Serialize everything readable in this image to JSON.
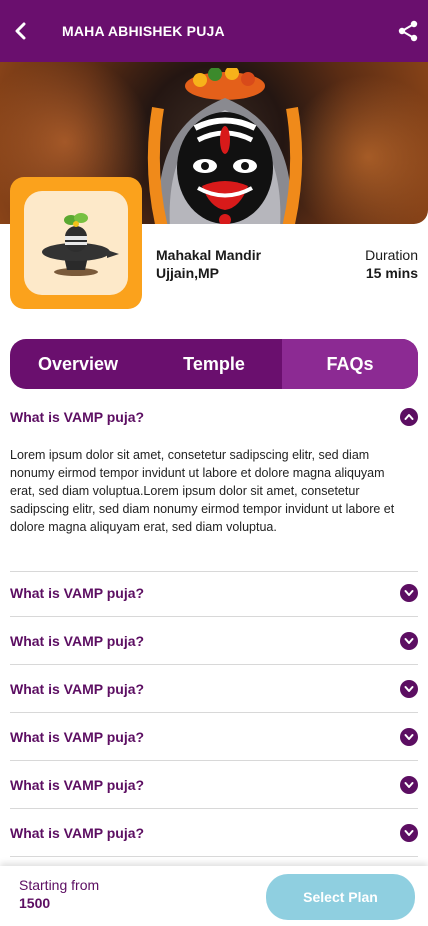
{
  "header": {
    "title": "MAHA ABHISHEK PUJA",
    "back_icon": "chevron-left-icon",
    "share_icon": "share-icon"
  },
  "colors": {
    "primary": "#6a0f6e",
    "tab_active": "#8c2a93",
    "accent_orange": "#fba21c",
    "button": "#8fcfe0",
    "text_purple": "#5c0e62"
  },
  "temple": {
    "name": "Mahakal Mandir",
    "city": "Ujjain,MP",
    "duration_label": "Duration",
    "duration_value": "15 mins"
  },
  "tabs": [
    {
      "label": "Overview"
    },
    {
      "label": "Temple"
    },
    {
      "label": "FAQs",
      "active": true
    }
  ],
  "faqs": [
    {
      "question": "What is VAMP puja?",
      "expanded": true,
      "answer": "Lorem ipsum dolor sit amet, consetetur sadipscing elitr, sed diam nonumy eirmod tempor invidunt ut labore et dolore magna aliquyam erat, sed diam voluptua.Lorem ipsum dolor sit amet, consetetur sadipscing elitr, sed diam nonumy eirmod tempor invidunt ut labore et dolore magna aliquyam erat, sed diam voluptua."
    },
    {
      "question": "What is VAMP puja?"
    },
    {
      "question": "What is VAMP puja?"
    },
    {
      "question": "What is VAMP puja?"
    },
    {
      "question": "What is VAMP puja?"
    },
    {
      "question": "What is VAMP puja?"
    },
    {
      "question": "What is VAMP puja?"
    }
  ],
  "footer": {
    "starting_label": "Starting from",
    "price": "1500",
    "button_label": "Select Plan"
  }
}
